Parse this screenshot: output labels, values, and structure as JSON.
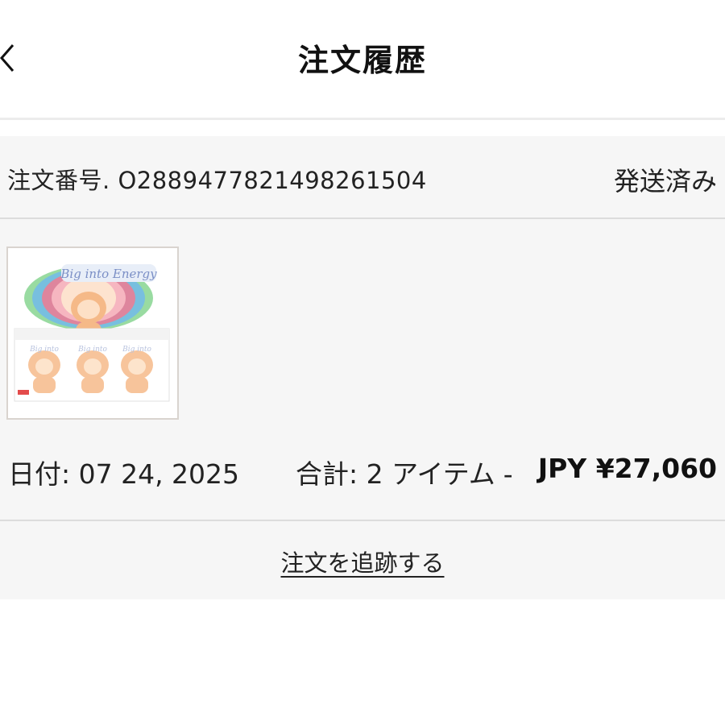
{
  "header": {
    "title": "注文履歴",
    "back_icon": "chevron-left-icon"
  },
  "order": {
    "number_label": "注文番号. ",
    "number": "O288947782149826150​4",
    "status": "発送済み",
    "product_image": {
      "icon": "product-box-image",
      "text": "Big into Energy"
    },
    "date_label": "日付: ",
    "date": "07 24, 2025",
    "total_label": "合計: ",
    "item_count": "2 アイテム",
    "separator": "-",
    "price": "JPY ¥27,060",
    "track_link": "注文を追跡する"
  }
}
